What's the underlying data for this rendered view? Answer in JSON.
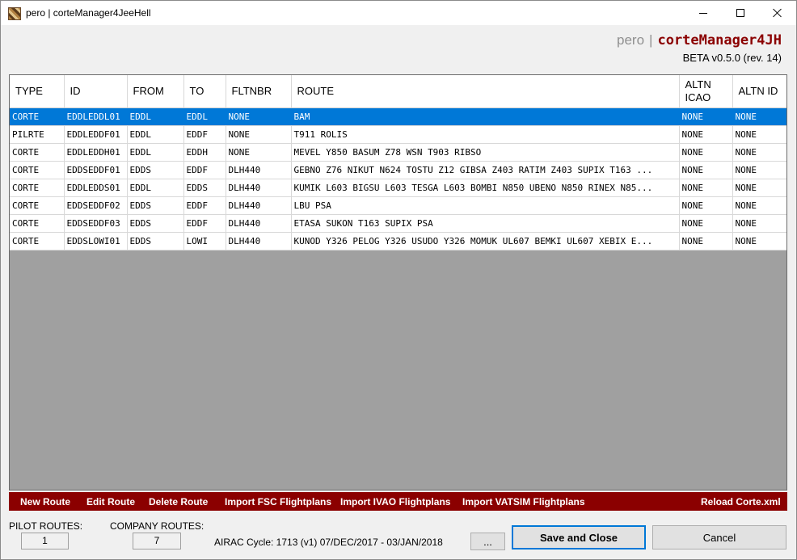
{
  "window": {
    "title": "pero | corteManager4JeeHell"
  },
  "header": {
    "user": "pero",
    "separator": "|",
    "app_name": "corteManager4JH",
    "version": "BETA v0.5.0 (rev. 14)"
  },
  "table": {
    "columns": [
      "TYPE",
      "ID",
      "FROM",
      "TO",
      "FLTNBR",
      "ROUTE",
      "ALTN ICAO",
      "ALTN ID"
    ],
    "rows": [
      [
        "CORTE",
        "EDDLEDDL01",
        "EDDL",
        "EDDL",
        "NONE",
        "BAM",
        "NONE",
        "NONE"
      ],
      [
        "PILRTE",
        "EDDLEDDF01",
        "EDDL",
        "EDDF",
        "NONE",
        "T911 ROLIS",
        "NONE",
        "NONE"
      ],
      [
        "CORTE",
        "EDDLEDDH01",
        "EDDL",
        "EDDH",
        "NONE",
        "MEVEL Y850 BASUM Z78 WSN T903 RIBSO",
        "NONE",
        "NONE"
      ],
      [
        "CORTE",
        "EDDSEDDF01",
        "EDDS",
        "EDDF",
        "DLH440",
        "GEBNO Z76 NIKUT N624 TOSTU Z12 GIBSA Z403 RATIM Z403 SUPIX T163 ...",
        "NONE",
        "NONE"
      ],
      [
        "CORTE",
        "EDDLEDDS01",
        "EDDL",
        "EDDS",
        "DLH440",
        "KUMIK L603 BIGSU L603 TESGA L603 BOMBI N850 UBENO N850 RINEX N85...",
        "NONE",
        "NONE"
      ],
      [
        "CORTE",
        "EDDSEDDF02",
        "EDDS",
        "EDDF",
        "DLH440",
        "LBU PSA",
        "NONE",
        "NONE"
      ],
      [
        "CORTE",
        "EDDSEDDF03",
        "EDDS",
        "EDDF",
        "DLH440",
        "ETASA SUKON T163 SUPIX PSA",
        "NONE",
        "NONE"
      ],
      [
        "CORTE",
        "EDDSLOWI01",
        "EDDS",
        "LOWI",
        "DLH440",
        "KUNOD Y326 PELOG Y326 USUDO Y326 MOMUK UL607 BEMKI UL607 XEBIX E...",
        "NONE",
        "NONE"
      ]
    ],
    "selected_row": 0
  },
  "actions": {
    "new_route": "New Route",
    "edit_route": "Edit Route",
    "delete_route": "Delete Route",
    "import_fsc": "Import FSC Flightplans",
    "import_ivao": "Import IVAO Flightplans",
    "import_vatsim": "Import VATSIM Flightplans",
    "reload": "Reload Corte.xml"
  },
  "footer": {
    "pilot_label": "PILOT ROUTES:",
    "pilot_count": "1",
    "company_label": "COMPANY ROUTES:",
    "company_count": "7",
    "airac": "AIRAC Cycle: 1713 (v1) 07/DEC/2017 - 03/JAN/2018",
    "dots_label": "...",
    "save_label": "Save and Close",
    "cancel_label": "Cancel"
  },
  "colors": {
    "accent": "#8b0000",
    "selection": "#0078d7",
    "grid_background": "#a0a0a0"
  }
}
